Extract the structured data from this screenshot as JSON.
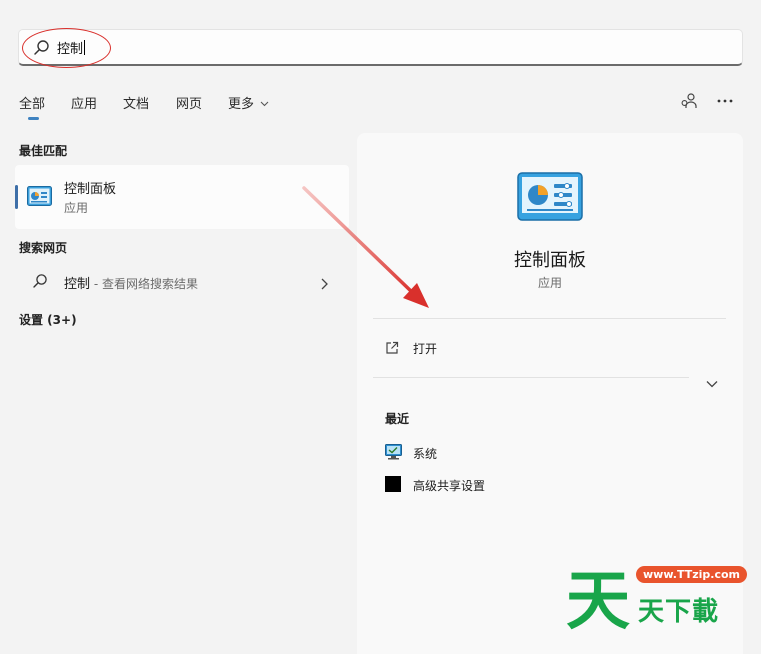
{
  "search": {
    "value": "控制"
  },
  "tabs": [
    "全部",
    "应用",
    "文档",
    "网页",
    "更多"
  ],
  "best_match": {
    "section_title": "最佳匹配",
    "name": "控制面板",
    "type": "应用"
  },
  "web": {
    "section_title": "搜索网页",
    "query": "控制",
    "suffix": " - 查看网络搜索结果"
  },
  "settings": {
    "section_title": "设置 (3+)"
  },
  "detail": {
    "name": "控制面板",
    "type": "应用",
    "open_label": "打开",
    "recent_title": "最近",
    "recent_items": [
      "系统",
      "高级共享设置"
    ]
  },
  "watermark": {
    "url": "www.TTzip.com",
    "text": "天天下載"
  },
  "colors": {
    "accent": "#3e82c0",
    "annotation": "#d9302c",
    "watermark_green": "#19a54a"
  }
}
